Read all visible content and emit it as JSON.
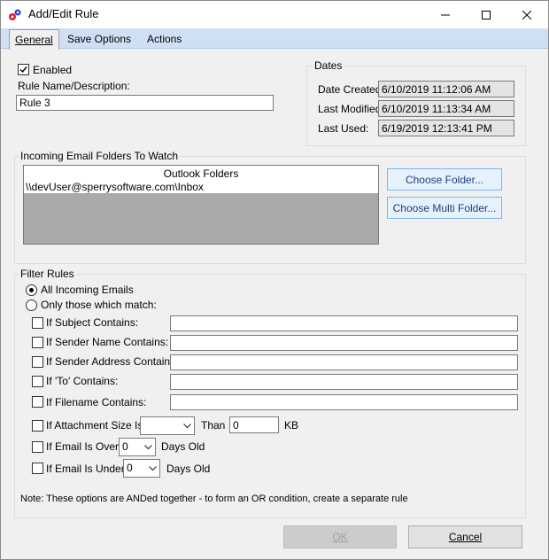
{
  "window": {
    "title": "Add/Edit Rule"
  },
  "tabs": [
    {
      "label": "General"
    },
    {
      "label": "Save Options"
    },
    {
      "label": "Actions"
    }
  ],
  "general": {
    "enabled_label": "Enabled",
    "enabled_checked": true,
    "rule_name_label": "Rule Name/Description:",
    "rule_name_value": "Rule 3"
  },
  "dates": {
    "group_label": "Dates",
    "created_label": "Date Created:",
    "created_value": "6/10/2019 11:12:06 AM",
    "modified_label": "Last Modified:",
    "modified_value": "6/10/2019 11:13:34 AM",
    "used_label": "Last Used:",
    "used_value": "6/19/2019 12:13:41 PM"
  },
  "folders": {
    "group_label": "Incoming Email Folders To Watch",
    "list_header": "Outlook Folders",
    "items": [
      "\\\\devUser@sperrysoftware.com\\Inbox"
    ],
    "choose_folder_label": "Choose Folder...",
    "choose_multi_label": "Choose Multi Folder..."
  },
  "filter": {
    "group_label": "Filter Rules",
    "all_label": "All Incoming Emails",
    "only_label": "Only those which match:",
    "subject_label": "If Subject Contains:",
    "sender_name_label": "If Sender Name Contains:",
    "sender_address_label": "If Sender Address Contains:",
    "to_label": "If 'To' Contains:",
    "filename_label": "If Filename Contains:",
    "attachment_label": "If Attachment Size Is",
    "attachment_op_value": "",
    "than_label": "Than",
    "than_value": "0",
    "kb_label": "KB",
    "over_label": "If Email Is Over",
    "over_value": "0",
    "over_days_label": "Days Old",
    "under_label": "If Email Is Under",
    "under_value": "0",
    "under_days_label": "Days Old",
    "note": "Note: These options are ANDed together - to form an OR condition, create a separate rule"
  },
  "footer": {
    "ok_label": "OK",
    "cancel_label": "Cancel"
  }
}
